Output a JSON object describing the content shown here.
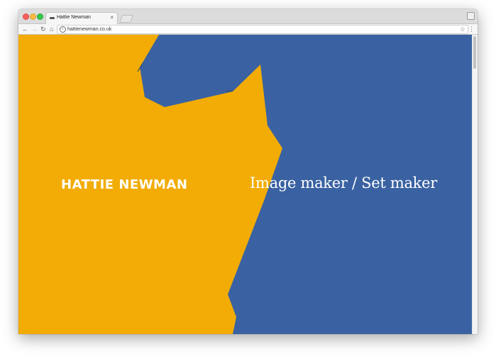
{
  "browser": {
    "tab_title": "Hattie Newman",
    "tab_close": "×",
    "url": "hattienewman.co.uk",
    "info": "i",
    "icons": {
      "back": "back-arrow-icon",
      "forward": "forward-arrow-icon",
      "reload": "reload-icon",
      "home": "home-icon",
      "bookmark": "star-icon",
      "menu": "kebab-menu-icon",
      "profile": "profile-icon"
    }
  },
  "page": {
    "site_name": "HATTIE NEWMAN",
    "tagline": "Image maker / Set maker"
  },
  "colors": {
    "yellow": "#F2AC05",
    "blue": "#3A62A2",
    "text": "#FFFFFF"
  }
}
